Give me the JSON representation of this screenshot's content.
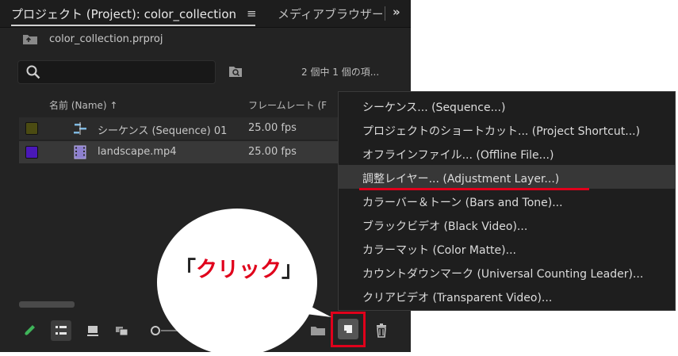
{
  "tabs": {
    "project": "プロジェクト (Project): color_collection",
    "project_menu_glyph": "≡",
    "media_browser": "メディアブラウザー",
    "overflow_glyph": "»"
  },
  "project_file": "color_collection.prproj",
  "search": {
    "placeholder": ""
  },
  "item_count": "2 個中 1 個の項...",
  "columns": {
    "name": "名前 (Name) ↑",
    "frame_rate": "フレームレート (F"
  },
  "rows": [
    {
      "name": "シーケンス (Sequence) 01",
      "fps": "25.00 fps",
      "label_color": "#4b4b12",
      "icon": "sequence-icon"
    },
    {
      "name": "landscape.mp4",
      "fps": "25.00 fps",
      "label_color": "#4a18b8",
      "icon": "video-clip-icon"
    }
  ],
  "toolbar": {
    "icons": [
      "pencil-icon",
      "list-view-icon",
      "icon-view-icon",
      "freeform-view-icon",
      "zoom-slider",
      "automate-to-sequence-icon",
      "new-bin-icon",
      "new-item-icon",
      "trash-icon"
    ]
  },
  "callout": {
    "open": "「",
    "word": "クリック",
    "close": "」",
    "accent": "#e0001b"
  },
  "menu": {
    "items": [
      "シーケンス... (Sequence...)",
      "プロジェクトのショートカット... (Project Shortcut...)",
      "オフラインファイル... (Offline File...)",
      "調整レイヤー... (Adjustment Layer...)",
      "カラーバー＆トーン (Bars and Tone)...",
      "ブラックビデオ (Black Video)...",
      "カラーマット (Color Matte)...",
      "カウントダウンマーク (Universal Counting Leader)...",
      "クリアビデオ (Transparent Video)..."
    ],
    "highlighted_index": 3
  }
}
